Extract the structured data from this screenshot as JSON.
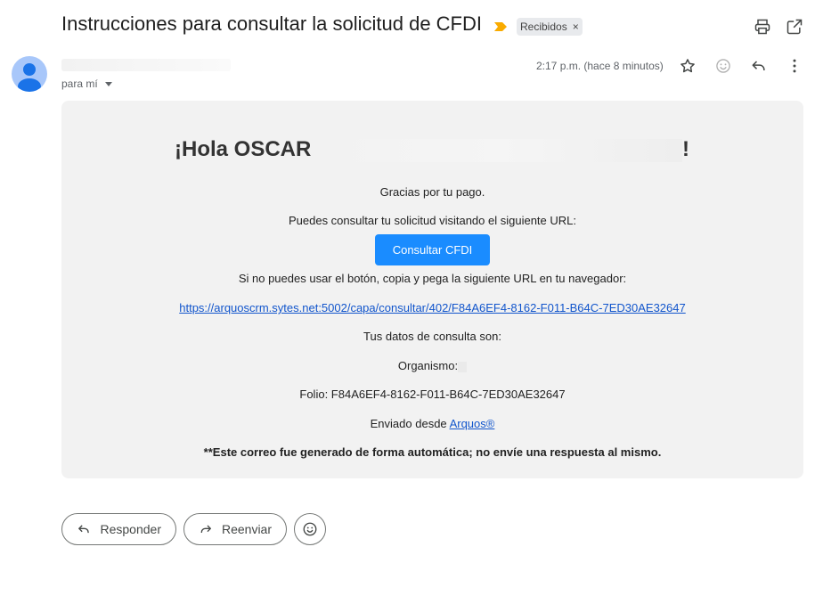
{
  "header": {
    "subject": "Instrucciones para consultar la solicitud de CFDI",
    "label": "Recibidos",
    "label_remove": "×",
    "icons": [
      "print-icon",
      "open-in-new-window-icon"
    ]
  },
  "message": {
    "recipient": "para mí",
    "time": "2:17 p.m. (hace 8 minutos)",
    "actions": [
      "star-icon",
      "emoji-icon",
      "reply-icon",
      "more-vert-icon"
    ]
  },
  "body": {
    "greeting_start": "¡Hola OSCAR",
    "greeting_end": "!",
    "thanks": "Gracias por tu pago.",
    "consult_line": "Puedes consultar tu solicitud visitando el siguiente URL:",
    "button_label": "Consultar CFDI",
    "fallback_line": "Si no puedes usar el botón, copia y pega la siguiente URL en tu navegador:",
    "url": "https://arquoscrm.sytes.net:5002/capa/consultar/402/F84A6EF4-8162-F011-B64C-7ED30AE32647",
    "data_heading": "Tus datos de consulta son:",
    "organismo_label": "Organismo:",
    "folio": "Folio: F84A6EF4-8162-F011-B64C-7ED30AE32647",
    "sent_from": "Enviado desde",
    "sent_from_link": "Arquos®",
    "auto_notice": "**Este correo fue generado de forma automática; no envíe una respuesta al mismo."
  },
  "footer": {
    "reply_label": "Responder",
    "forward_label": "Reenviar"
  },
  "colors": {
    "primary_button": "#1a8cff",
    "link": "#1155cc",
    "card_bg": "#f2f2f2",
    "avatar_bg": "#a8c7fa",
    "important_marker": "#f9ab00"
  }
}
